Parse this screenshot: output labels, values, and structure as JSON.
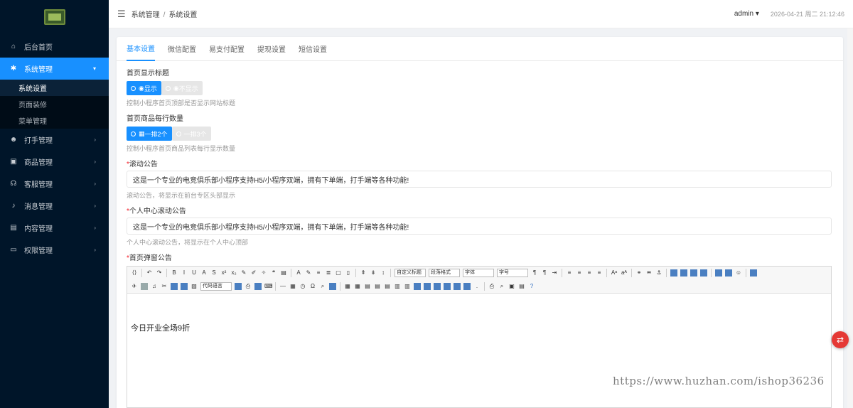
{
  "sidebar": {
    "items": [
      {
        "label": "后台首页",
        "icon": "home-icon"
      },
      {
        "label": "系统管理",
        "icon": "gear-icon",
        "active": true
      },
      {
        "label": "打手管理",
        "icon": "users-icon"
      },
      {
        "label": "商品管理",
        "icon": "shop-icon"
      },
      {
        "label": "客服管理",
        "icon": "headset-icon"
      },
      {
        "label": "消息管理",
        "icon": "bell-icon"
      },
      {
        "label": "内容管理",
        "icon": "file-icon"
      },
      {
        "label": "权限管理",
        "icon": "monitor-icon"
      }
    ],
    "sub_items": [
      {
        "label": "系统设置",
        "active": true
      },
      {
        "label": "页面装修"
      },
      {
        "label": "菜单管理"
      }
    ]
  },
  "header": {
    "breadcrumb": [
      "系统管理",
      "系统设置"
    ],
    "breadcrumb_sep": "/",
    "user": "admin",
    "datetime": "2026-04-21 周二 21:12:46"
  },
  "tabs": [
    "基本设置",
    "微信配置",
    "易支付配置",
    "提现设置",
    "短信设置"
  ],
  "form": {
    "title_label": "首页显示标题",
    "title_options": [
      "显示",
      "不显示"
    ],
    "title_help": "控制小程序首页顶部是否显示网站标题",
    "count_label": "首页商品每行数量",
    "count_options": [
      "一排2个",
      "一排3个"
    ],
    "count_help": "控制小程序首页商品列表每行显示数量",
    "scroll_label": "滚动公告",
    "scroll_value": "这是一个专业的电竞俱乐部小程序支持H5/小程序双端，拥有下单端，打手端等各种功能!",
    "scroll_help": "滚动公告，将显示在前台专区头部显示",
    "personal_label": "个人中心滚动公告",
    "personal_value": "这是一个专业的电竞俱乐部小程序支持H5/小程序双端，拥有下单端，打手端等各种功能!",
    "personal_help": "个人中心滚动公告，将显示在个人中心顶部",
    "popup_label": "首页弹窗公告",
    "required_mark": "*",
    "editor_content": "今日开业全场9折",
    "editor_selects": [
      "自定义标题",
      "段落格式",
      "字体",
      "字号",
      "代码语言"
    ]
  },
  "watermark": "https://www.huzhan.com/ishop36236"
}
